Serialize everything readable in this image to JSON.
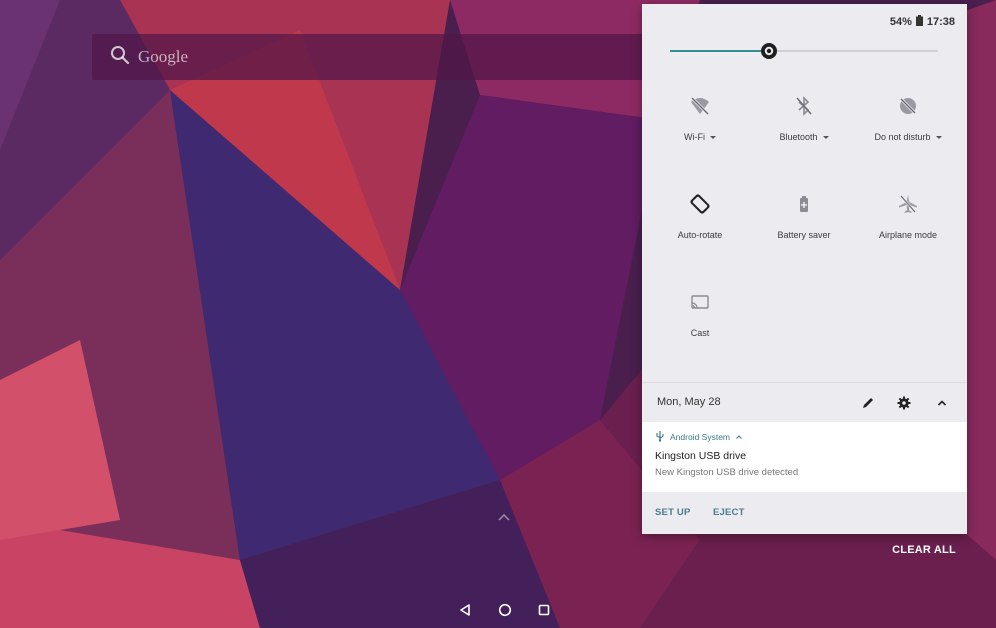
{
  "colors": {
    "accent": "#2f8f93",
    "panel_bg": "#ecebf0",
    "notification_app": "#3b7a8a"
  },
  "search": {
    "placeholder": "Google",
    "icon": "search-icon"
  },
  "status_bar": {
    "battery_percent": "54%",
    "time": "17:38",
    "icon": "battery-icon"
  },
  "brightness": {
    "level": 0.37
  },
  "quick_settings": {
    "tiles": [
      {
        "label": "Wi-Fi",
        "icon": "wifi-off-icon",
        "has_dropdown": true
      },
      {
        "label": "Bluetooth",
        "icon": "bluetooth-off-icon",
        "has_dropdown": true
      },
      {
        "label": "Do not disturb",
        "icon": "do-not-disturb-icon",
        "has_dropdown": true
      },
      {
        "label": "Auto-rotate",
        "icon": "auto-rotate-icon",
        "has_dropdown": false
      },
      {
        "label": "Battery saver",
        "icon": "battery-saver-icon",
        "has_dropdown": false
      },
      {
        "label": "Airplane mode",
        "icon": "airplane-mode-icon",
        "has_dropdown": false
      },
      {
        "label": "Cast",
        "icon": "cast-icon",
        "has_dropdown": false
      }
    ]
  },
  "date_row": {
    "date": "Mon, May 28",
    "actions": [
      "edit-icon",
      "settings-icon",
      "collapse-icon"
    ]
  },
  "notification": {
    "app_name": "Android System",
    "app_icon": "usb-icon",
    "title": "Kingston USB drive",
    "body": "New Kingston USB drive detected",
    "actions": [
      "SET UP",
      "EJECT"
    ]
  },
  "clear_all_label": "CLEAR ALL",
  "navigation": [
    "back-icon",
    "home-icon",
    "recents-icon"
  ]
}
